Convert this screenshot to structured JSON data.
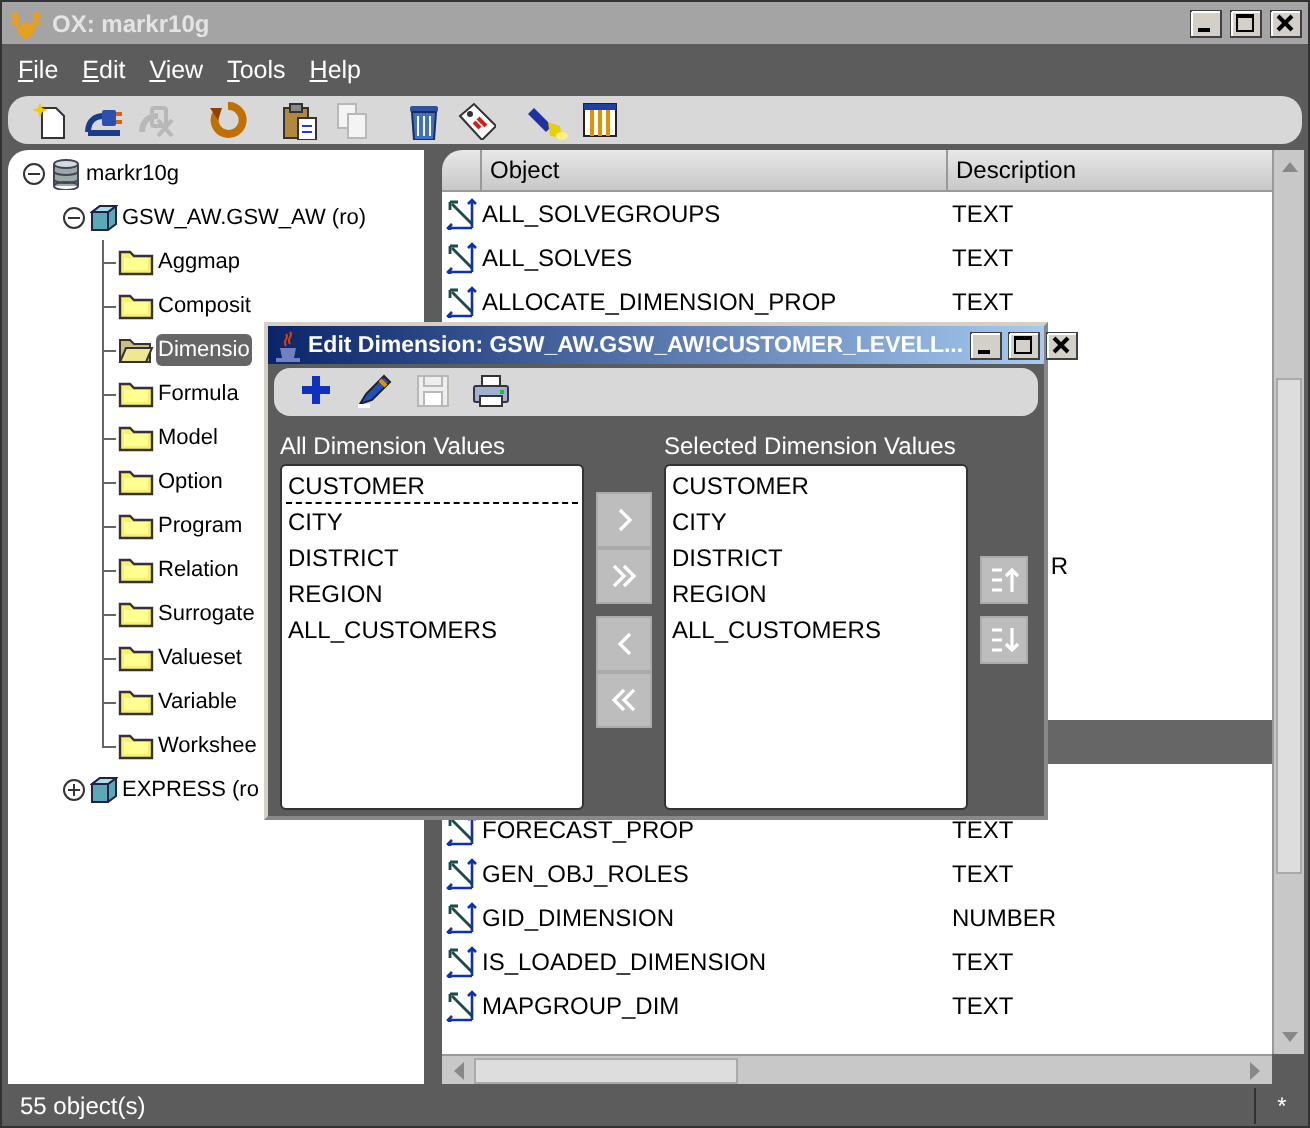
{
  "window": {
    "title": "OX: markr10g",
    "active": false
  },
  "menu": [
    {
      "label": "File"
    },
    {
      "label": "Edit"
    },
    {
      "label": "View"
    },
    {
      "label": "Tools"
    },
    {
      "label": "Help"
    }
  ],
  "toolbar": [
    [
      {
        "kind": "new",
        "disabled": false
      },
      {
        "kind": "connect",
        "disabled": false
      },
      {
        "kind": "disconnect",
        "disabled": true
      }
    ],
    [
      {
        "kind": "refresh",
        "disabled": false
      }
    ],
    [
      {
        "kind": "paste",
        "disabled": false
      },
      {
        "kind": "copy",
        "disabled": true
      }
    ],
    [
      {
        "kind": "delete",
        "disabled": false
      },
      {
        "kind": "tag",
        "disabled": false
      }
    ],
    [
      {
        "kind": "find",
        "disabled": false
      },
      {
        "kind": "columns",
        "disabled": false
      }
    ]
  ],
  "tree": [
    {
      "label": "markr10g",
      "kind": "database",
      "expanded": true,
      "children": [
        {
          "label": "GSW_AW.GSW_AW (ro)",
          "kind": "workspace",
          "expanded": true,
          "children": [
            {
              "label": "Aggmap",
              "kind": "folder",
              "selected": false
            },
            {
              "label": "Composit",
              "kind": "folder",
              "selected": false
            },
            {
              "label": "Dimensio",
              "kind": "folder",
              "selected": true
            },
            {
              "label": "Formula",
              "kind": "folder",
              "selected": false
            },
            {
              "label": "Model",
              "kind": "folder",
              "selected": false
            },
            {
              "label": "Option",
              "kind": "folder",
              "selected": false
            },
            {
              "label": "Program",
              "kind": "folder",
              "selected": false
            },
            {
              "label": "Relation",
              "kind": "folder",
              "selected": false
            },
            {
              "label": "Surrogate",
              "kind": "folder",
              "selected": false
            },
            {
              "label": "Valueset",
              "kind": "folder",
              "selected": false
            },
            {
              "label": "Variable",
              "kind": "folder",
              "selected": false
            },
            {
              "label": "Workshee",
              "kind": "folder",
              "selected": false
            }
          ]
        },
        {
          "label": "EXPRESS (ro",
          "kind": "workspace",
          "expanded": false
        }
      ]
    }
  ],
  "table": {
    "columns": [
      "Object",
      "Description"
    ],
    "rows": [
      {
        "object": "ALL_SOLVEGROUPS",
        "description": "TEXT",
        "selected": false
      },
      {
        "object": "ALL_SOLVES",
        "description": "TEXT",
        "selected": false
      },
      {
        "object": "ALLOCATE_DIMENSION_PROP",
        "description": "TEXT",
        "selected": false
      },
      {
        "selected": false
      },
      {
        "selected": false
      },
      {
        "selected": false
      },
      {
        "selected": false
      },
      {
        "selected": false
      },
      {
        "description": "R",
        "kind": "clipped",
        "selected": false
      },
      {
        "selected": false
      },
      {
        "selected": false
      },
      {
        "selected": false
      },
      {
        "selected": true
      },
      {
        "selected": false
      },
      {
        "object": "FORECAST_PROP",
        "description": "TEXT",
        "selected": false
      },
      {
        "object": "GEN_OBJ_ROLES",
        "description": "TEXT",
        "selected": false
      },
      {
        "object": "GID_DIMENSION",
        "description": "NUMBER",
        "selected": false
      },
      {
        "object": "IS_LOADED_DIMENSION",
        "description": "TEXT",
        "selected": false
      },
      {
        "object": "MAPGROUP_DIM",
        "description": "TEXT",
        "selected": false
      }
    ]
  },
  "status_bar": {
    "text": "55 object(s)",
    "indicator": "*"
  },
  "dialog": {
    "title": "Edit Dimension: GSW_AW.GSW_AW!CUSTOMER_LEVELL...",
    "active": true,
    "toolbar": [
      {
        "kind": "add",
        "disabled": false
      },
      {
        "kind": "edit",
        "disabled": false
      },
      {
        "kind": "save",
        "disabled": true
      },
      {
        "kind": "print",
        "disabled": false
      }
    ],
    "all_values": {
      "label": "All Dimension Values",
      "items": [
        {
          "text": "CUSTOMER",
          "focused": true
        },
        {
          "text": "CITY",
          "focused": false
        },
        {
          "text": "DISTRICT",
          "focused": false
        },
        {
          "text": "REGION",
          "focused": false
        },
        {
          "text": "ALL_CUSTOMERS",
          "focused": false
        }
      ]
    },
    "move_buttons": [
      {
        "kind": "right",
        "disabled": true
      },
      {
        "kind": "all_right",
        "disabled": true
      },
      {
        "kind": "left",
        "disabled": true
      },
      {
        "kind": "all_left",
        "disabled": true
      }
    ],
    "selected_values": {
      "label": "Selected Dimension Values",
      "items": [
        {
          "text": "CUSTOMER",
          "focused": false
        },
        {
          "text": "CITY",
          "focused": false
        },
        {
          "text": "DISTRICT",
          "focused": false
        },
        {
          "text": "REGION",
          "focused": false
        },
        {
          "text": "ALL_CUSTOMERS",
          "focused": false
        }
      ]
    },
    "order_buttons": [
      {
        "kind": "up",
        "disabled": true
      },
      {
        "kind": "down",
        "disabled": true
      }
    ]
  }
}
